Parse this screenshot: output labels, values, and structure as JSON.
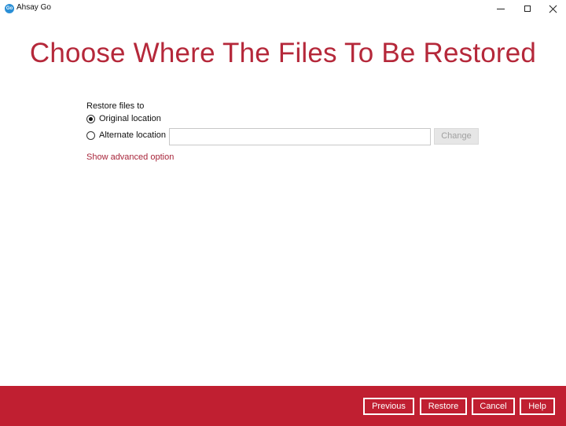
{
  "window": {
    "app_icon_text": "Go",
    "title": "Ahsay Go"
  },
  "page": {
    "title": "Choose Where The Files To Be Restored"
  },
  "restore": {
    "label": "Restore files to",
    "options": [
      {
        "label": "Original location",
        "selected": true
      },
      {
        "label": "Alternate location",
        "selected": false
      }
    ],
    "alternate_path_value": "",
    "change_label": "Change",
    "advanced_link": "Show advanced option"
  },
  "footer": {
    "previous_label": "Previous",
    "restore_label": "Restore",
    "cancel_label": "Cancel",
    "help_label": "Help"
  },
  "colors": {
    "accent": "#c01f31",
    "title": "#b5283a",
    "link": "#a8263b"
  }
}
